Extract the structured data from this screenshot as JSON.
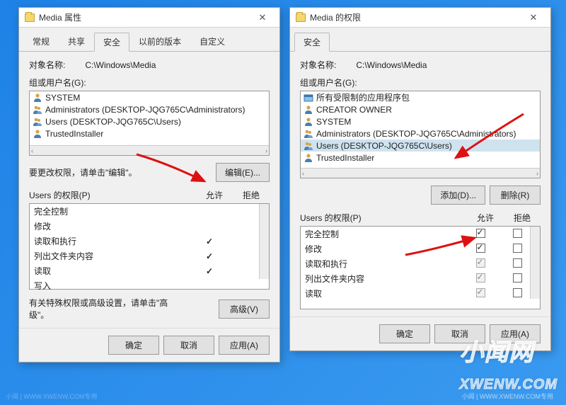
{
  "left": {
    "title": "Media 属性",
    "tabs": [
      "常规",
      "共享",
      "安全",
      "以前的版本",
      "自定义"
    ],
    "active_tab_index": 2,
    "object_label": "对象名称:",
    "object_path": "C:\\Windows\\Media",
    "group_label": "组或用户名(G):",
    "principals": [
      {
        "icon": "user",
        "text": "SYSTEM"
      },
      {
        "icon": "users",
        "text": "Administrators (DESKTOP-JQG765C\\Administrators)"
      },
      {
        "icon": "users",
        "text": "Users (DESKTOP-JQG765C\\Users)"
      },
      {
        "icon": "user",
        "text": "TrustedInstaller"
      }
    ],
    "edit_hint": "要更改权限，请单击\"编辑\"。",
    "edit_btn": "编辑(E)...",
    "perm_label": "Users 的权限(P)",
    "col_allow": "允许",
    "col_deny": "拒绝",
    "perms": [
      {
        "name": "完全控制",
        "allow": false,
        "deny": false
      },
      {
        "name": "修改",
        "allow": false,
        "deny": false
      },
      {
        "name": "读取和执行",
        "allow": true,
        "deny": false
      },
      {
        "name": "列出文件夹内容",
        "allow": true,
        "deny": false
      },
      {
        "name": "读取",
        "allow": true,
        "deny": false
      },
      {
        "name": "写入",
        "allow": false,
        "deny": false
      }
    ],
    "adv_hint": "有关特殊权限或高级设置，请单击\"高级\"。",
    "adv_btn": "高级(V)",
    "ok": "确定",
    "cancel": "取消",
    "apply": "应用(A)"
  },
  "right": {
    "title": "Media 的权限",
    "tabs": [
      "安全"
    ],
    "object_label": "对象名称:",
    "object_path": "C:\\Windows\\Media",
    "group_label": "组或用户名(G):",
    "principals": [
      {
        "icon": "pkg",
        "text": "所有受限制的应用程序包"
      },
      {
        "icon": "user",
        "text": "CREATOR OWNER"
      },
      {
        "icon": "user",
        "text": "SYSTEM"
      },
      {
        "icon": "users",
        "text": "Administrators (DESKTOP-JQG765C\\Administrators)"
      },
      {
        "icon": "users",
        "text": "Users (DESKTOP-JQG765C\\Users)",
        "selected": true
      },
      {
        "icon": "user",
        "text": "TrustedInstaller"
      }
    ],
    "add_btn": "添加(D)...",
    "remove_btn": "删除(R)",
    "perm_label": "Users 的权限(P)",
    "col_allow": "允许",
    "col_deny": "拒绝",
    "perms": [
      {
        "name": "完全控制",
        "allow": true,
        "deny": false
      },
      {
        "name": "修改",
        "allow": true,
        "deny": false
      },
      {
        "name": "读取和执行",
        "allow": true,
        "deny": false,
        "dis": true
      },
      {
        "name": "列出文件夹内容",
        "allow": true,
        "deny": false,
        "dis": true
      },
      {
        "name": "读取",
        "allow": true,
        "deny": false,
        "dis": true
      }
    ],
    "ok": "确定",
    "cancel": "取消",
    "apply": "应用(A)"
  },
  "watermark_big": "小闻网",
  "watermark_url": "XWENW.COM",
  "watermark_small": "小闻 | WWW.XWENW.COM专用"
}
